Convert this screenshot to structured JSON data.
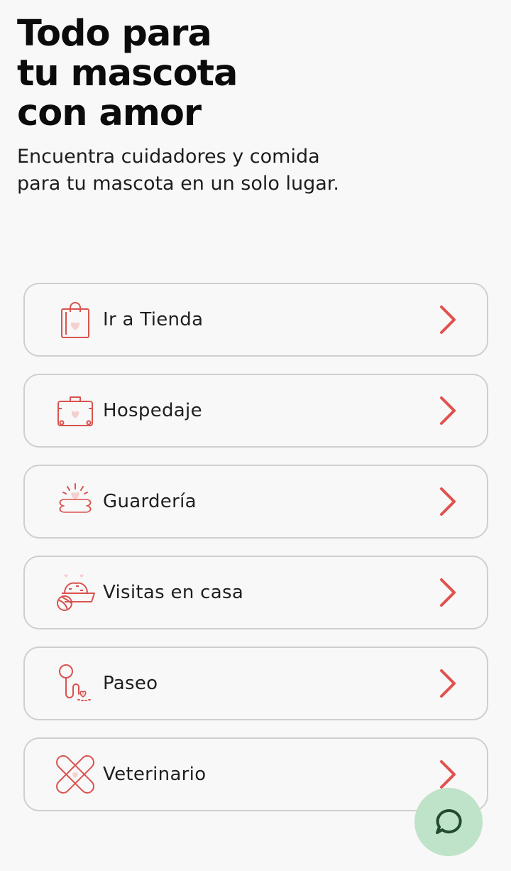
{
  "hero": {
    "title_lines": [
      "Todo para",
      "tu mascota",
      "con amor"
    ],
    "subtitle": "Encuentra cuidadores y comida para tu mascota en un solo lugar."
  },
  "menu": {
    "items": [
      {
        "label": "Ir a Tienda",
        "icon": "shopping-bag-icon"
      },
      {
        "label": "Hospedaje",
        "icon": "suitcase-icon"
      },
      {
        "label": "Guardería",
        "icon": "bone-icon"
      },
      {
        "label": "Visitas en casa",
        "icon": "pet-bowl-icon"
      },
      {
        "label": "Paseo",
        "icon": "leash-icon"
      },
      {
        "label": "Veterinario",
        "icon": "bandage-icon"
      }
    ]
  },
  "chat_button": {
    "icon": "chat-bubble-icon"
  },
  "colors": {
    "accent_red": "#e0524f",
    "icon_stroke": "#d9534f",
    "icon_fill_pink": "#f6cfcf",
    "fab_green": "#bfe3c8",
    "fab_icon": "#234a2e",
    "card_border": "#cfcfcf"
  }
}
